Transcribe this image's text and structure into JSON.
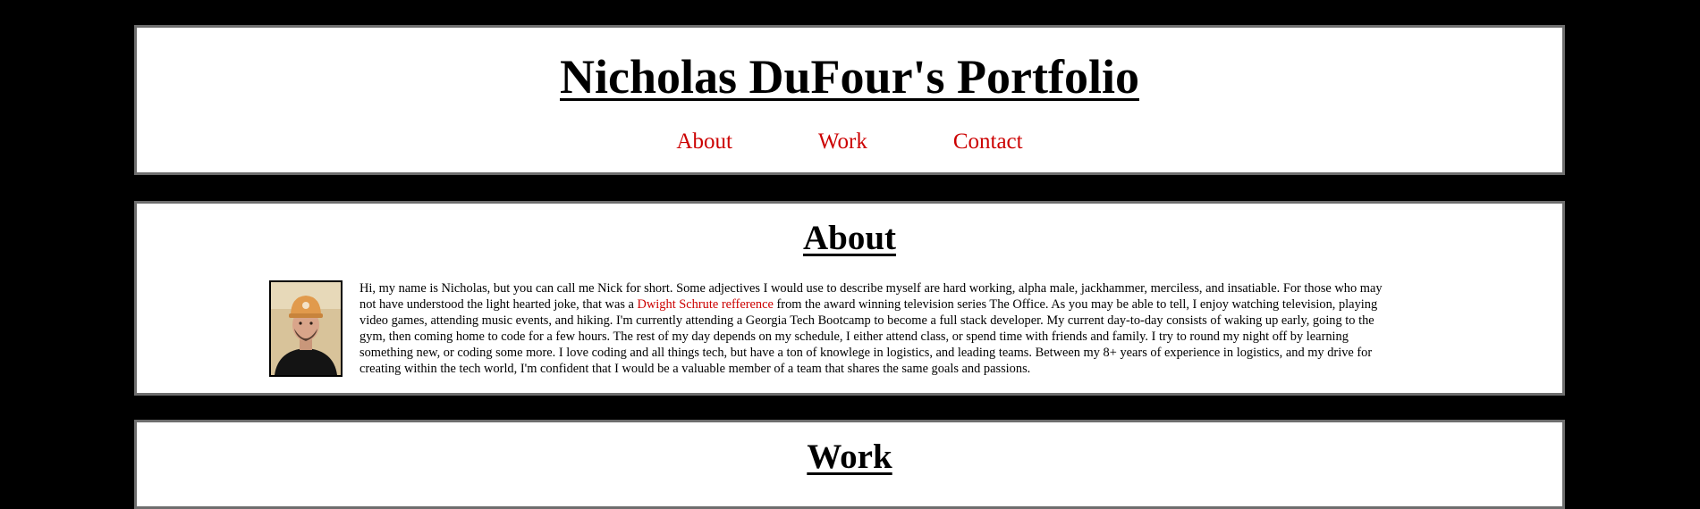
{
  "header": {
    "title": "Nicholas DuFour's Portfolio",
    "nav": [
      {
        "label": "About"
      },
      {
        "label": "Work"
      },
      {
        "label": "Contact"
      }
    ]
  },
  "about": {
    "title": "About",
    "photo_alt": "profile-photo",
    "text_before": "Hi, my name is Nicholas, but you can call me Nick for short. Some adjectives I would use to describe myself are hard working, alpha male, jackhammer, merciless, and insatiable. For those who may not have understood the light hearted joke, that was a ",
    "link_text": "Dwight Schrute refference",
    "text_after": " from the award winning television series The Office. As you may be able to tell, I enjoy watching television, playing video games, attending music events, and hiking. I'm currently attending a Georgia Tech Bootcamp to become a full stack developer. My current day-to-day consists of waking up early, going to the gym, then coming home to code for a few hours. The rest of my day depends on my schedule, I either attend class, or spend time with friends and family. I try to round my night off by learning something new, or coding some more. I love coding and all things tech, but have a ton of knowlege in logistics, and leading teams. Between my 8+ years of experience in logistics, and my drive for creating within the tech world, I'm confident that I would be a valuable member of a team that shares the same goals and passions."
  },
  "work": {
    "title": "Work"
  },
  "colors": {
    "background": "#000000",
    "panel": "#ffffff",
    "panel_border": "#6e6e6e",
    "link": "#cc0000"
  }
}
